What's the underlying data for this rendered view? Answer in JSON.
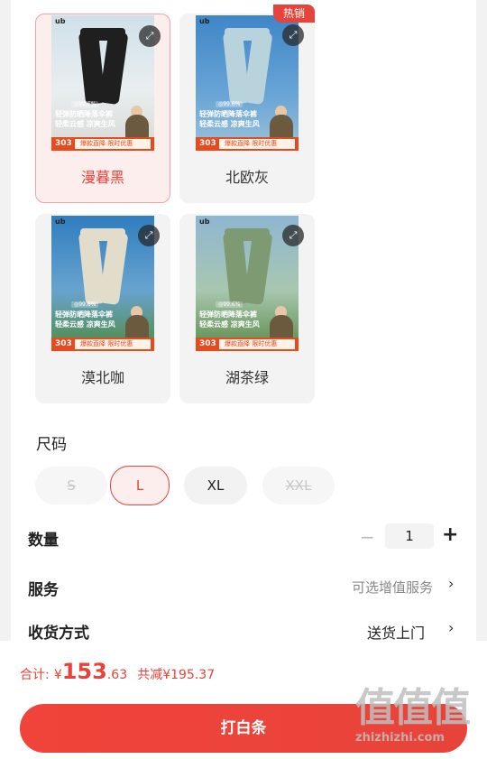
{
  "colors": {
    "accent": "#e8433a",
    "selected_bg": "#fdeeee",
    "chip_bg": "#f2f2f2",
    "promo_strip": "#e8491d"
  },
  "variants": [
    {
      "label": "漫暮黑",
      "selected": true,
      "hot": false,
      "bg": "linear-gradient(180deg,#cfe0ea 0%,#e9eef0 55%,#d7d9d4 100%)",
      "pant": "#1f1f1f",
      "icon": "expand-icon"
    },
    {
      "label": "北欧灰",
      "selected": false,
      "hot": true,
      "bg": "linear-gradient(180deg,#3f86c8 0%,#6aa5d6 60%,#9cc2d9 100%)",
      "pant": "#b9d3dc",
      "icon": "expand-icon"
    },
    {
      "label": "漠北咖",
      "selected": false,
      "hot": false,
      "bg": "linear-gradient(180deg,#2f7dbf 0%,#68a3cf 55%,#4f8b3e 100%)",
      "pant": "#e2dccb",
      "icon": "expand-icon"
    },
    {
      "label": "湖茶绿",
      "selected": false,
      "hot": false,
      "bg": "linear-gradient(180deg,#8fb6d3 0%,#a8c7b0 55%,#5a8a48 100%)",
      "pant": "#7e9a72",
      "icon": "expand-icon"
    }
  ],
  "hot_label": "热销",
  "photo": {
    "logo": "ub",
    "badge": "◎99.6%",
    "promo_line1": "轻弹防晒降落伞裤",
    "promo_line2": "轻柔云感 凉爽生风",
    "price": "303",
    "deal": "爆款直降 限时优惠"
  },
  "size_section": {
    "title": "尺码",
    "options": [
      {
        "label": "S",
        "state": "disabled"
      },
      {
        "label": "L",
        "state": "selected"
      },
      {
        "label": "XL",
        "state": "normal"
      },
      {
        "label": "XXL",
        "state": "disabled"
      }
    ]
  },
  "quantity": {
    "label": "数量",
    "value": "1",
    "minus": "−",
    "plus": "+"
  },
  "service": {
    "label": "服务",
    "value": "可选增值服务",
    "chevron": "›"
  },
  "delivery": {
    "label": "收货方式",
    "value": "送货上门",
    "chevron": "›"
  },
  "checkout": {
    "total_label": "合计:",
    "currency": "¥",
    "price_int": "153",
    "price_dec": ".63",
    "discount": "共减¥195.37",
    "button": "打白条"
  },
  "watermark": {
    "big": "值值值",
    "small": "zhizhizhi.com"
  }
}
